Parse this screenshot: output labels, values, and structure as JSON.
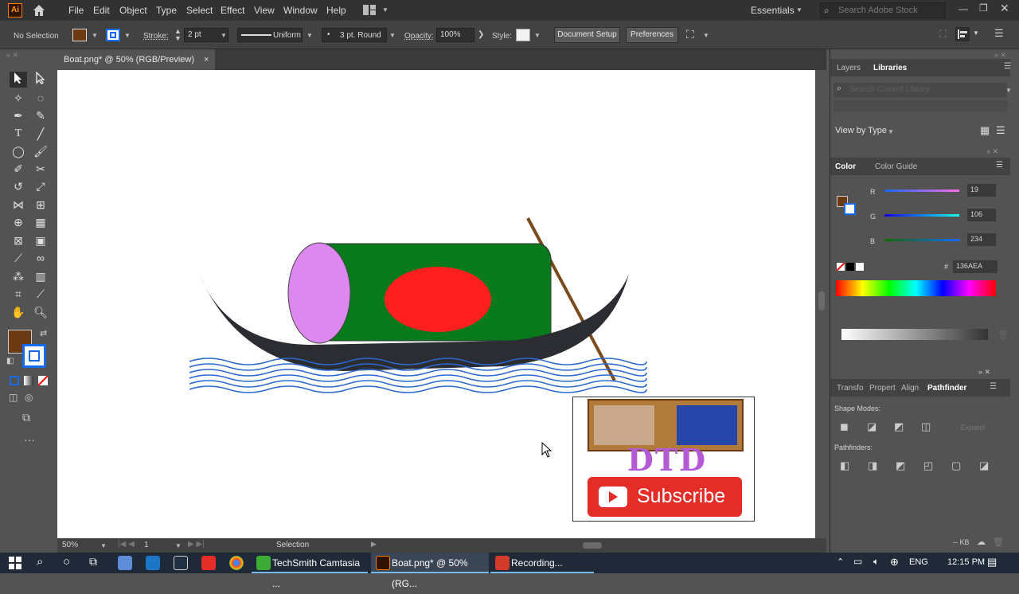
{
  "menubar": {
    "logo": "Ai",
    "items": [
      "File",
      "Edit",
      "Object",
      "Type",
      "Select",
      "Effect",
      "View",
      "Window",
      "Help"
    ],
    "workspace": "Essentials",
    "search_placeholder": "Search Adobe Stock"
  },
  "control": {
    "selection": "No Selection",
    "stroke_label": "Stroke:",
    "stroke_weight": "2 pt",
    "profile": "Uniform",
    "brush": "3 pt. Round",
    "opacity_label": "Opacity:",
    "opacity_value": "100%",
    "style_label": "Style:",
    "doc_setup": "Document Setup",
    "preferences": "Preferences"
  },
  "document": {
    "tab_title": "Boat.png* @ 50% (RGB/Preview)",
    "close": "×"
  },
  "artwork": {
    "subscribe_text": "Subscribe",
    "logo_text": "DTD"
  },
  "status": {
    "zoom": "50%",
    "artboard": "1",
    "tool": "Selection"
  },
  "panels": {
    "layers_tab": "Layers",
    "libraries_tab": "Libraries",
    "search_libraries_placeholder": "Search Current Library",
    "view_by": "View by Type",
    "color_tab": "Color",
    "color_guide_tab": "Color Guide",
    "r_label": "R",
    "r_value": "19",
    "g_label": "G",
    "g_value": "106",
    "b_label": "B",
    "b_value": "234",
    "hex_label": "#",
    "hex_value": "136AEA",
    "bottom_tabs": [
      "Transfo",
      "Propert",
      "Align",
      "Pathfinder"
    ],
    "shape_modes": "Shape Modes:",
    "expand": "Expand",
    "pathfinders": "Pathfinders:",
    "kb": "-- KB"
  },
  "taskbar": {
    "apps": [
      "TechSmith Camtasia ...",
      "Boat.png* @ 50% (RG...",
      "Recording..."
    ],
    "lang": "ENG",
    "time": "12:15 PM"
  },
  "colors": {
    "fill": "#6b3a12",
    "stroke_blue": "#136AEA",
    "boat": "#2b2d33",
    "cabin_green": "#087a1c",
    "circle_red": "#ff1f1f",
    "cabin_front": "#dd88ee",
    "oar": "#7a4a1a",
    "water": "#2a6ad0",
    "subscribe_red": "#e52d27"
  }
}
